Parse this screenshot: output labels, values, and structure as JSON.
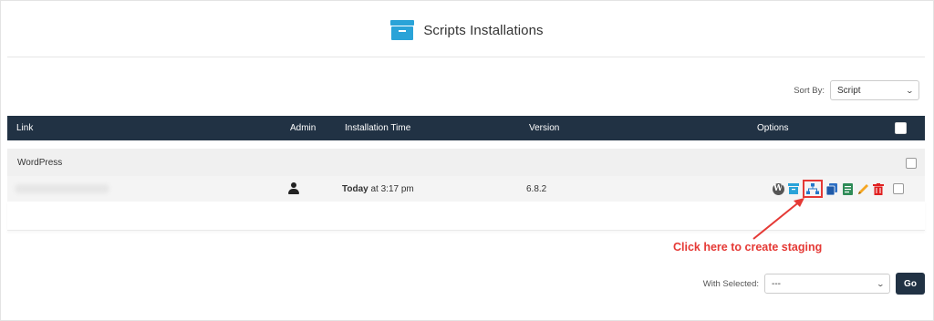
{
  "header": {
    "title": "Scripts Installations",
    "icon": "archive-box-icon",
    "accent": "#2aa3d8"
  },
  "sort": {
    "label": "Sort By:",
    "value": "Script"
  },
  "table": {
    "columns": [
      "Link",
      "Admin",
      "Installation Time",
      "Version",
      "Options"
    ],
    "header_bg": "#213244",
    "group": {
      "name": "WordPress"
    },
    "rows": [
      {
        "link": "",
        "admin_icon": "user-icon",
        "time_bold": "Today",
        "time_rest": " at 3:17 pm",
        "version": "6.8.2",
        "options": [
          "wordpress-icon",
          "backup-icon",
          "staging-icon",
          "clone-icon",
          "copy-icon",
          "edit-icon",
          "delete-icon"
        ]
      }
    ]
  },
  "annotation": {
    "text": "Click here to create staging",
    "color": "#e53935"
  },
  "bulk": {
    "label": "With Selected:",
    "value": "---",
    "go_label": "Go"
  }
}
